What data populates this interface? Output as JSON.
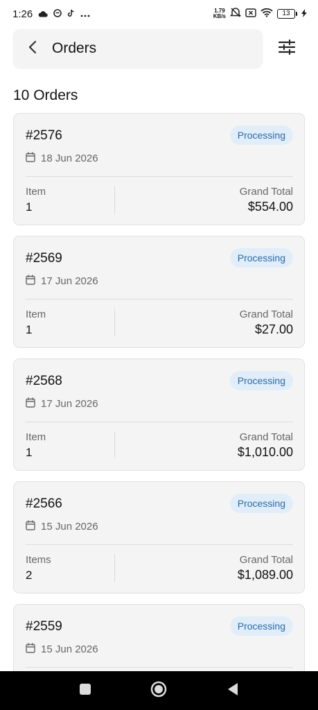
{
  "status_bar": {
    "time": "1:26",
    "net_speed_value": "1.79",
    "net_speed_unit": "KB/s",
    "battery_level": "13",
    "left_icons": [
      "cloud-icon",
      "face-icon",
      "tiktok-icon",
      "more-dots-icon"
    ],
    "right_icons": [
      "mute-icon",
      "sim-x-icon",
      "wifi-icon",
      "battery-icon",
      "charging-icon"
    ]
  },
  "header": {
    "title": "Orders",
    "back_icon": "chevron-left-icon",
    "filter_icon": "sliders-icon"
  },
  "orders_count": "10 Orders",
  "colors": {
    "badge_bg": "#e1eefa",
    "badge_text": "#2a6aa6",
    "card_bg": "#f4f4f4"
  },
  "orders": [
    {
      "id": "#2576",
      "status": "Processing",
      "date": "18 Jun 2026",
      "item_label": "Item",
      "item_count": "1",
      "total_label": "Grand Total",
      "total": "$554.00"
    },
    {
      "id": "#2569",
      "status": "Processing",
      "date": "17 Jun 2026",
      "item_label": "Item",
      "item_count": "1",
      "total_label": "Grand Total",
      "total": "$27.00"
    },
    {
      "id": "#2568",
      "status": "Processing",
      "date": "17 Jun 2026",
      "item_label": "Item",
      "item_count": "1",
      "total_label": "Grand Total",
      "total": "$1,010.00"
    },
    {
      "id": "#2566",
      "status": "Processing",
      "date": "15 Jun 2026",
      "item_label": "Items",
      "item_count": "2",
      "total_label": "Grand Total",
      "total": "$1,089.00"
    },
    {
      "id": "#2559",
      "status": "Processing",
      "date": "15 Jun 2026",
      "item_label": "",
      "item_count": "",
      "total_label": "",
      "total": ""
    }
  ],
  "nav_bar": {
    "buttons": [
      "recents-icon",
      "home-icon",
      "back-icon"
    ]
  }
}
